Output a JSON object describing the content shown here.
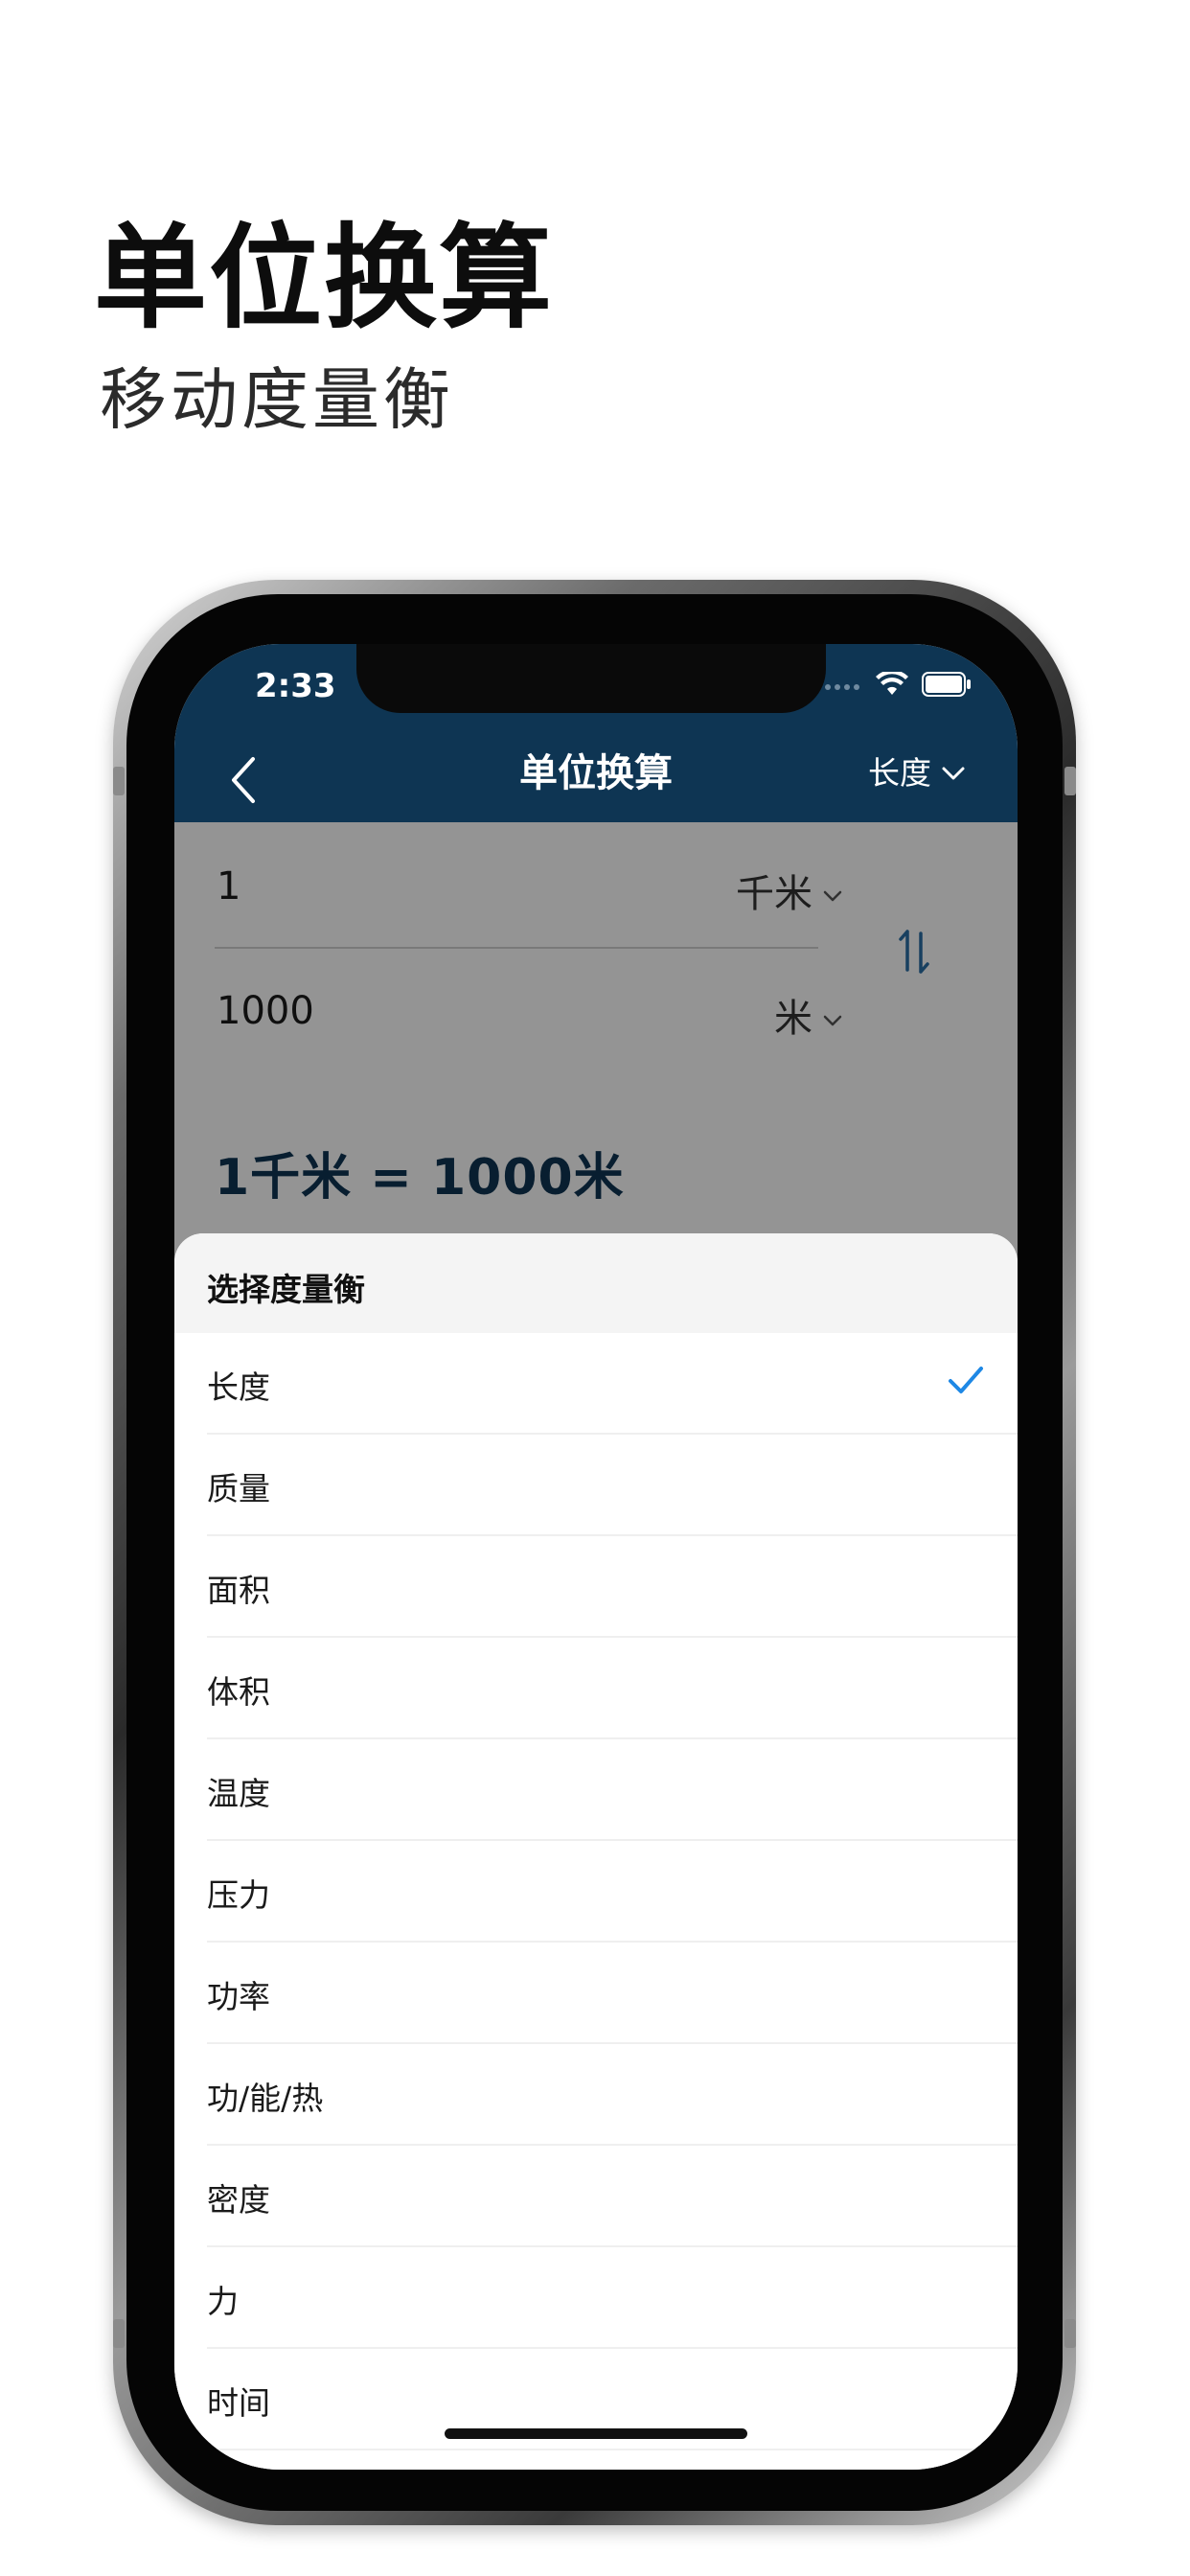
{
  "promo": {
    "title": "单位换算",
    "subtitle": "移动度量衡"
  },
  "status_bar": {
    "time": "2:33",
    "icons": [
      "wifi-icon",
      "battery-icon"
    ]
  },
  "nav": {
    "title": "单位换算",
    "category": "长度"
  },
  "converter": {
    "from": {
      "value": "1",
      "unit": "千米"
    },
    "to": {
      "value": "1000",
      "unit": "米"
    },
    "result": "1千米 = 1000米"
  },
  "sheet": {
    "title": "选择度量衡",
    "selected": "长度",
    "items": [
      "长度",
      "质量",
      "面积",
      "体积",
      "温度",
      "压力",
      "功率",
      "功/能/热",
      "密度",
      "力",
      "时间"
    ]
  },
  "colors": {
    "header": "#0e3553",
    "accent": "#1e88e5",
    "result_text": "#0e3553"
  }
}
